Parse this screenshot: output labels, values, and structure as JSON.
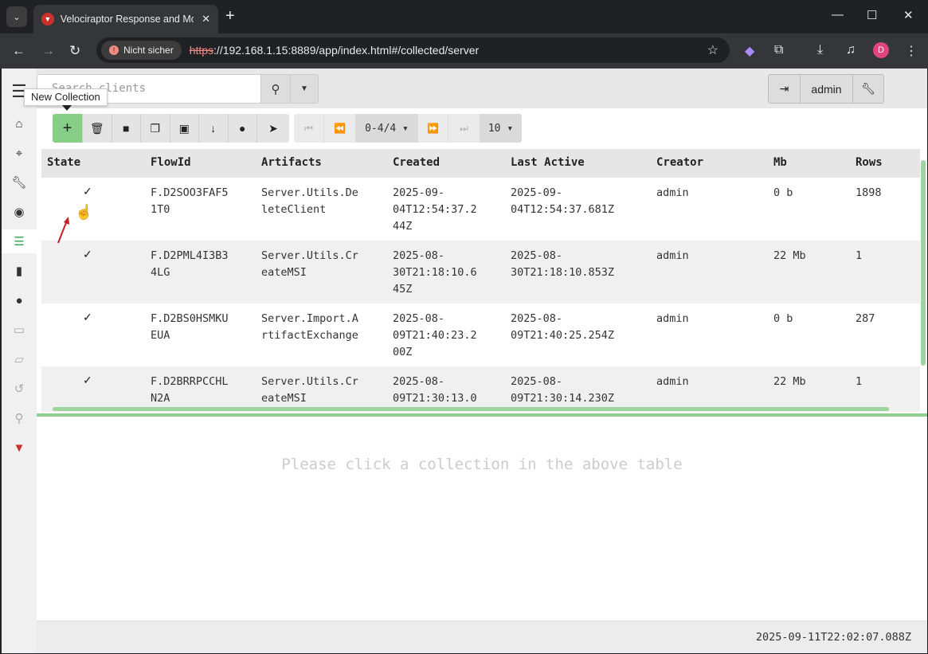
{
  "browser": {
    "tab_title": "Velociraptor Response and Mon",
    "security_chip": "Nicht sicher",
    "url_scheme": "https",
    "url_rest": "://192.168.1.15:8889/app/index.html#/collected/server",
    "profile_initial": "D"
  },
  "topnav": {
    "search_placeholder": "Search clients",
    "user": "admin"
  },
  "tooltip": "New Collection",
  "pager": {
    "range": "0-4/4",
    "page_size": "10"
  },
  "table": {
    "headers": [
      "State",
      "FlowId",
      "Artifacts",
      "Created",
      "Last Active",
      "Creator",
      "Mb",
      "Rows"
    ],
    "rows": [
      {
        "state": "✓",
        "flow_id": "F.D2SOO3FAF5\n1T0",
        "artifact": "Server.Utils.De\nleteClient",
        "created": "2025-09-\n04T12:54:37.2\n44Z",
        "last_active": "2025-09-\n04T12:54:37.681Z",
        "creator": "admin",
        "mb": "0 b",
        "rows": "1898"
      },
      {
        "state": "✓",
        "flow_id": "F.D2PML4I3B3\n4LG",
        "artifact": "Server.Utils.Cr\neateMSI",
        "created": "2025-08-\n30T21:18:10.6\n45Z",
        "last_active": "2025-08-\n30T21:18:10.853Z",
        "creator": "admin",
        "mb": "22 Mb",
        "rows": "1"
      },
      {
        "state": "✓",
        "flow_id": "F.D2BS0HSMKU\nEUA",
        "artifact": "Server.Import.A\nrtifactExchange",
        "created": "2025-08-\n09T21:40:23.2\n00Z",
        "last_active": "2025-08-\n09T21:40:25.254Z",
        "creator": "admin",
        "mb": "0 b",
        "rows": "287"
      },
      {
        "state": "✓",
        "flow_id": "F.D2BRRPCCHL\nN2A",
        "artifact": "Server.Utils.Cr\neateMSI",
        "created": "2025-08-\n09T21:30:13.0",
        "last_active": "2025-08-\n09T21:30:14.230Z",
        "creator": "admin",
        "mb": "22 Mb",
        "rows": "1"
      }
    ]
  },
  "placeholder": "Please click a collection in the above table",
  "footer_time": "2025-09-11T22:02:07.088Z"
}
